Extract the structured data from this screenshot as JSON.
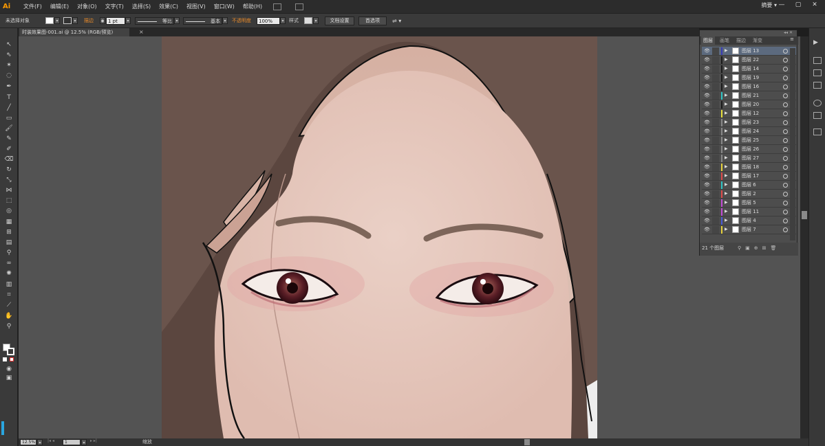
{
  "menubar": {
    "logo": "Ai",
    "items": [
      "文件(F)",
      "编辑(E)",
      "对象(O)",
      "文字(T)",
      "选择(S)",
      "效果(C)",
      "视图(V)",
      "窗口(W)",
      "帮助(H)"
    ],
    "workspace": "摘要",
    "workspace_arrow": "▾"
  },
  "window_controls": {
    "minimize": "—",
    "maximize": "▢",
    "close": "✕"
  },
  "control_bar": {
    "selection_label": "未选择对象",
    "stroke_label": "描边",
    "stroke_weight": "1 pt",
    "stroke_profile": "等比",
    "brush": "基本",
    "opacity_label": "不透明度",
    "opacity_value": "100%",
    "style_label": "样式",
    "doc_setup_button": "文档设置",
    "preferences_button": "首选项"
  },
  "document_tab": {
    "title": "时装效果图-001.ai @ 12.5% (RGB/预览)",
    "close": "×"
  },
  "status_bar": {
    "zoom": "12.5%",
    "page": "1",
    "mode": "缩放"
  },
  "layers_panel": {
    "tabs": [
      "图层",
      "画笔",
      "描边",
      "渐变"
    ],
    "active_tab": "图层",
    "layers": [
      {
        "name": "图层 13",
        "color": "#3a3ab4",
        "selected": true
      },
      {
        "name": "图层 22",
        "color": "#1a1a1a"
      },
      {
        "name": "图层 14",
        "color": "#1a1a1a"
      },
      {
        "name": "图层 19",
        "color": "#1a1a1a"
      },
      {
        "name": "图层 16",
        "color": "#1a1a1a"
      },
      {
        "name": "图层 21",
        "color": "#2ec4c4"
      },
      {
        "name": "图层 20",
        "color": "#1a1a1a"
      },
      {
        "name": "图层 12",
        "color": "#e8e03a"
      },
      {
        "name": "图层 23",
        "color": "#888888"
      },
      {
        "name": "图层 24",
        "color": "#888888"
      },
      {
        "name": "图层 25",
        "color": "#888888"
      },
      {
        "name": "图层 26",
        "color": "#888888"
      },
      {
        "name": "图层 27",
        "color": "#888888"
      },
      {
        "name": "图层 18",
        "color": "#e8d23a"
      },
      {
        "name": "图层 17",
        "color": "#e04a4a"
      },
      {
        "name": "图层 6",
        "color": "#2ec4c4"
      },
      {
        "name": "图层 2",
        "color": "#e04a4a"
      },
      {
        "name": "图层 5",
        "color": "#c44ad6"
      },
      {
        "name": "图层 11",
        "color": "#c44ad6"
      },
      {
        "name": "图层 4",
        "color": "#4a5ad6"
      },
      {
        "name": "图层 7",
        "color": "#e8d23a"
      }
    ],
    "count_label": "21 个图层"
  },
  "colors": {
    "accent": "#ff9a00",
    "selected_row": "#5c6a7e"
  }
}
